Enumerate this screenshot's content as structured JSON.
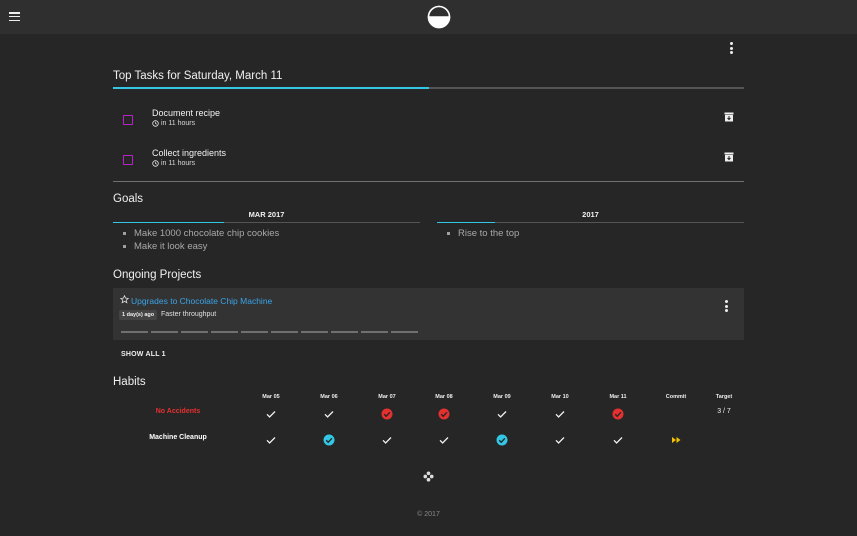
{
  "topbar": {
    "menu_icon": "hamburger-menu-icon",
    "logo_icon": "half-circle-logo-icon"
  },
  "tasks": {
    "heading": "Top Tasks for Saturday, March 11",
    "progress_fraction": 0.5,
    "items": [
      {
        "title": "Document recipe",
        "due": "in 11 hours"
      },
      {
        "title": "Collect ingredients",
        "due": "in 11 hours"
      }
    ]
  },
  "goals": {
    "heading": "Goals",
    "month": {
      "label": "MAR 2017",
      "progress_fraction": 0.36,
      "items": [
        "Make 1000 chocolate chip cookies",
        "Make it look easy"
      ]
    },
    "year": {
      "label": "2017",
      "progress_fraction": 0.19,
      "items": [
        "Rise to the top"
      ]
    }
  },
  "projects": {
    "heading": "Ongoing Projects",
    "items": [
      {
        "title": "Upgrades to Chocolate Chip Machine",
        "badge": "1 day(s) ago",
        "description": "Faster throughput",
        "milestones_done": 0,
        "milestones_total": 10
      }
    ],
    "show_all": "SHOW ALL 1"
  },
  "habits": {
    "heading": "Habits",
    "columns": [
      "Mar 05",
      "Mar 06",
      "Mar 07",
      "Mar 08",
      "Mar 09",
      "Mar 10",
      "Mar 11"
    ],
    "commit_label": "Commit",
    "target_label": "Target",
    "rows": [
      {
        "name": "No Accidents",
        "color": "#e53030",
        "cells": [
          "check",
          "check",
          "red",
          "red",
          "check",
          "check",
          "red"
        ],
        "commit": "",
        "target": "3 / 7"
      },
      {
        "name": "Machine Cleanup",
        "color": "#ffffff",
        "cells": [
          "check",
          "blue",
          "check",
          "check",
          "blue",
          "check",
          "check"
        ],
        "commit": "fast-forward",
        "target": ""
      }
    ]
  },
  "colors": {
    "accent": "#33c7e6",
    "checkbox": "#b524c9",
    "link": "#3aa4e8",
    "bad": "#e53030",
    "good": "#33c7e6",
    "commit": "#f2c200"
  },
  "footer": "© 2017"
}
